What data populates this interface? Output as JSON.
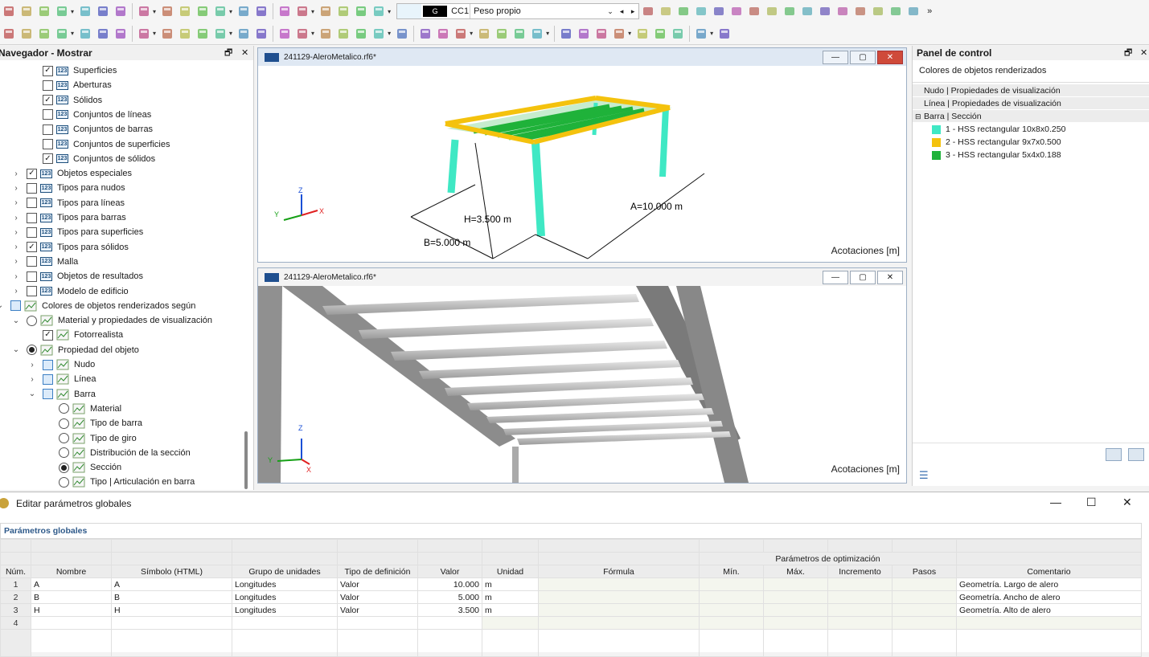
{
  "toolbar": {
    "load_case": {
      "tag": "G",
      "id": "CC1",
      "name": "Peso propio"
    },
    "more": "»"
  },
  "navigator": {
    "title": "Navegador - Mostrar",
    "items": [
      {
        "label": "Superficies",
        "checked": true
      },
      {
        "label": "Aberturas",
        "checked": false
      },
      {
        "label": "Sólidos",
        "checked": true
      },
      {
        "label": "Conjuntos de líneas",
        "checked": false
      },
      {
        "label": "Conjuntos de barras",
        "checked": false
      },
      {
        "label": "Conjuntos de superficies",
        "checked": false
      },
      {
        "label": "Conjuntos de sólidos",
        "checked": true
      },
      {
        "label": "Objetos especiales",
        "checked": true
      },
      {
        "label": "Tipos para nudos",
        "checked": false
      },
      {
        "label": "Tipos para líneas",
        "checked": false
      },
      {
        "label": "Tipos para barras",
        "checked": false
      },
      {
        "label": "Tipos para superficies",
        "checked": false
      },
      {
        "label": "Tipos para sólidos",
        "checked": true
      },
      {
        "label": "Malla",
        "checked": false
      },
      {
        "label": "Objetos de resultados",
        "checked": false
      },
      {
        "label": "Modelo de edificio",
        "checked": false
      },
      {
        "label": "Colores de objetos renderizados según"
      },
      {
        "label": "Material y propiedades de visualización"
      },
      {
        "label": "Fotorrealista"
      },
      {
        "label": "Propiedad del objeto"
      },
      {
        "label": "Nudo"
      },
      {
        "label": "Línea"
      },
      {
        "label": "Barra"
      },
      {
        "label": "Material"
      },
      {
        "label": "Tipo de barra"
      },
      {
        "label": "Tipo de giro"
      },
      {
        "label": "Distribución de la sección"
      },
      {
        "label": "Sección"
      },
      {
        "label": "Tipo | Articulación en barra"
      }
    ]
  },
  "viewport1": {
    "title": "241129-AleroMetalico.rf6*",
    "caption": "Acotaciones [m]",
    "dims": {
      "A": "A=10.000 m",
      "B": "B=5.000 m",
      "H": "H=3.500 m"
    },
    "axes": {
      "x": "X",
      "y": "Y",
      "z": "Z"
    }
  },
  "viewport2": {
    "title": "241129-AleroMetalico.rf6*",
    "caption": "Acotaciones [m]",
    "axes": {
      "x": "X",
      "y": "Y",
      "z": "Z"
    }
  },
  "control_panel": {
    "title": "Panel de control",
    "subtitle": "Colores de objetos renderizados",
    "rows": [
      "Nudo | Propiedades de visualización",
      "Línea | Propiedades de visualización",
      "Barra | Sección"
    ],
    "legend": [
      {
        "label": "1 - HSS rectangular 10x8x0.250",
        "color": "#3fe8c4"
      },
      {
        "label": "2 - HSS rectangular 9x7x0.500",
        "color": "#f4c20d"
      },
      {
        "label": "3 - HSS rectangular 5x4x0.188",
        "color": "#1fb23a"
      }
    ]
  },
  "dialog": {
    "title": "Editar parámetros globales",
    "group": "Parámetros globales",
    "optim_header": "Parámetros de optimización",
    "columns": [
      "Núm.",
      "Nombre",
      "Símbolo (HTML)",
      "Grupo de unidades",
      "Tipo de definición",
      "Valor",
      "Unidad",
      "Fórmula",
      "Mín.",
      "Máx.",
      "Incremento",
      "Pasos",
      "Comentario"
    ],
    "rows": [
      {
        "num": "1",
        "name": "A",
        "symbol": "A",
        "group": "Longitudes",
        "def": "Valor",
        "value": "10.000",
        "unit": "m",
        "formula": "",
        "min": "",
        "max": "",
        "inc": "",
        "steps": "",
        "comment": "Geometría. Largo de alero"
      },
      {
        "num": "2",
        "name": "B",
        "symbol": "B",
        "group": "Longitudes",
        "def": "Valor",
        "value": "5.000",
        "unit": "m",
        "formula": "",
        "min": "",
        "max": "",
        "inc": "",
        "steps": "",
        "comment": "Geometría. Ancho de alero"
      },
      {
        "num": "3",
        "name": "H",
        "symbol": "H",
        "group": "Longitudes",
        "def": "Valor",
        "value": "3.500",
        "unit": "m",
        "formula": "",
        "min": "",
        "max": "",
        "inc": "",
        "steps": "",
        "comment": "Geometría. Alto de alero"
      },
      {
        "num": "4",
        "name": "",
        "symbol": "",
        "group": "",
        "def": "",
        "value": "",
        "unit": "",
        "formula": "",
        "min": "",
        "max": "",
        "inc": "",
        "steps": "",
        "comment": ""
      }
    ]
  }
}
